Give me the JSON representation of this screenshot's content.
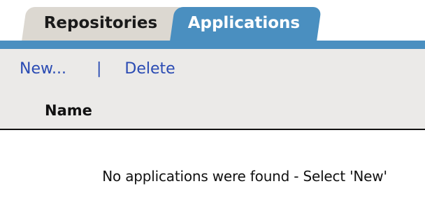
{
  "tabs": {
    "repositories": "Repositories",
    "applications": "Applications"
  },
  "toolbar": {
    "new_label": "New...",
    "separator": "|",
    "delete_label": "Delete"
  },
  "table": {
    "columns": [
      "Name"
    ]
  },
  "empty_message": "No applications were found - Select 'New'",
  "colors": {
    "accent": "#4a8fc0",
    "inactive_tab": "#dcd8d1",
    "link": "#2a4bb3",
    "panel_bg": "#ebeae8"
  }
}
